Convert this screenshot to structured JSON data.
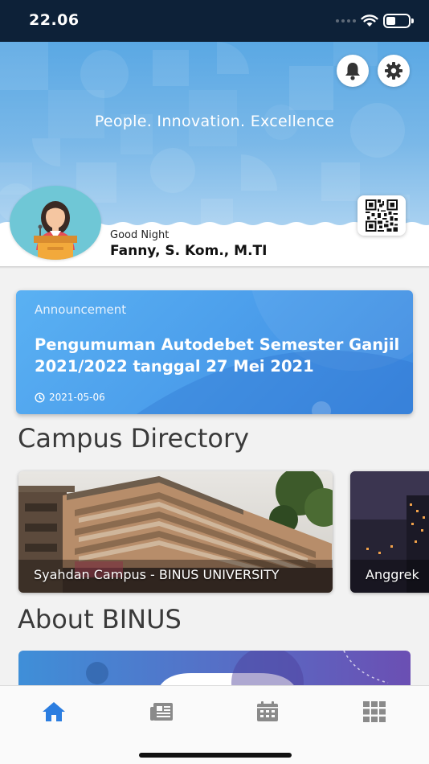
{
  "status_bar": {
    "time": "22.06"
  },
  "header": {
    "tagline": "People. Innovation. Excellence",
    "greeting": "Good Night",
    "user_name": "Fanny, S. Kom., M.TI",
    "icons": [
      "bell-icon",
      "gear-icon",
      "qr-code-icon"
    ]
  },
  "announcement": {
    "label": "Announcement",
    "title": "Pengumuman Autodebet Semester Ganjil 2021/2022 tanggal 27 Mei 2021",
    "date": "2021-05-06"
  },
  "campus_directory": {
    "title": "Campus Directory",
    "cards": [
      {
        "label": "Syahdan Campus - BINUS UNIVERSITY"
      },
      {
        "label": "Anggrek"
      }
    ]
  },
  "about": {
    "title": "About BINUS"
  },
  "bottom_nav": {
    "items": [
      {
        "icon": "home-icon",
        "active": true
      },
      {
        "icon": "news-icon",
        "active": false
      },
      {
        "icon": "calendar-icon",
        "active": false
      },
      {
        "icon": "apps-grid-icon",
        "active": false
      }
    ]
  },
  "colors": {
    "accent": "#2b7de0",
    "status_bar": "#0d2138",
    "nav_inactive": "#8a8a8a"
  }
}
